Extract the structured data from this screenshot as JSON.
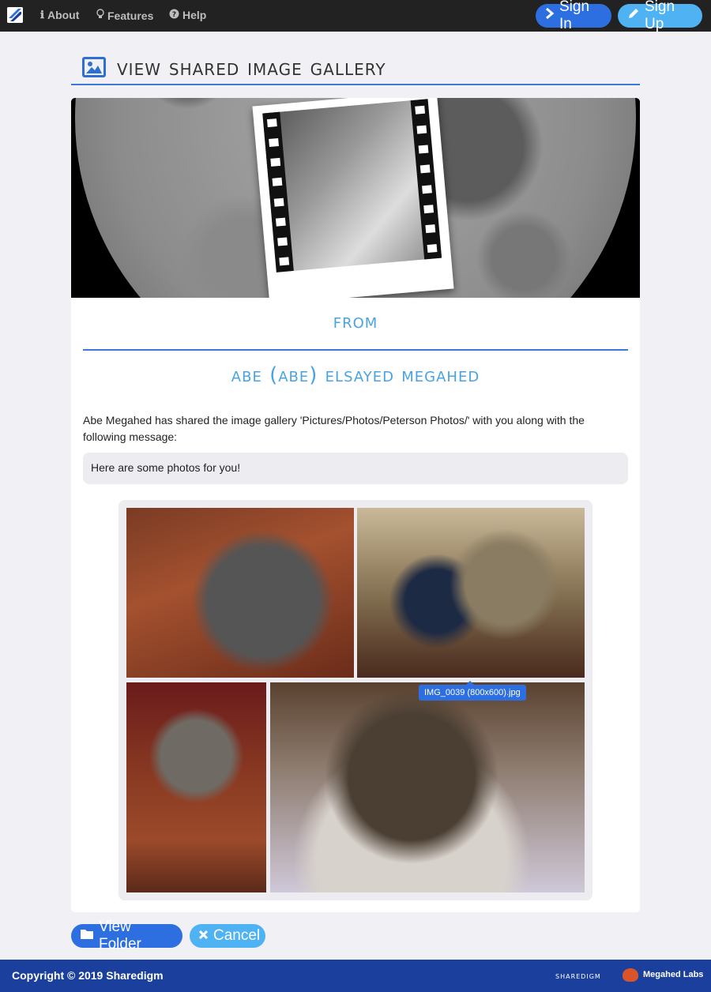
{
  "nav": {
    "about": "About",
    "features": "Features",
    "help": "Help",
    "signin": "Sign In",
    "signup": "Sign Up"
  },
  "page": {
    "title": "View Shared Image Gallery"
  },
  "share": {
    "from_label": "From",
    "sender_name": "Abe (abe) Elsayed Megahed",
    "description": "Abe Megahed has shared the image gallery 'Pictures/Photos/Peterson Photos/' with you along with the following message:",
    "message": "Here are some photos for you!"
  },
  "gallery": {
    "tooltip": "IMG_0039 (800x600).jpg",
    "photo_count": 4
  },
  "actions": {
    "view_folder": "View Folder",
    "cancel": "Cancel"
  },
  "footer": {
    "copyright": "Copyright © 2019 Sharedigm",
    "brand": "Sharedigm",
    "labs": "Megahed Labs"
  },
  "colors": {
    "primary": "#2d6fe0",
    "secondary": "#4fb2f2",
    "accent_text": "#4aa3e0",
    "footer_bg": "#1b3f9c",
    "navbar_bg": "#222222"
  }
}
